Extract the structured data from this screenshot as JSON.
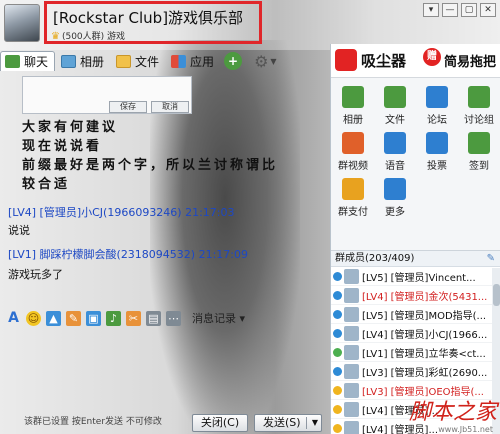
{
  "header": {
    "title": "[Rockstar Club]游戏俱乐部",
    "subtitle": "(500人群) 游戏",
    "win_buttons": [
      "▾",
      "—",
      "▢",
      "✕"
    ]
  },
  "tabs": [
    {
      "label": "聊天",
      "icon": "chat-bubble-icon"
    },
    {
      "label": "相册",
      "icon": "photo-album-icon"
    },
    {
      "label": "文件",
      "icon": "folder-icon"
    },
    {
      "label": "应用",
      "icon": "app-grid-icon"
    }
  ],
  "popup": {
    "save_label": "保存",
    "cancel_label": "取消"
  },
  "notice": {
    "lines": [
      "大家有何建议",
      "现在说说看",
      "前缀最好是两个字，所以兰讨称谓比",
      "较合适"
    ]
  },
  "messages": [
    {
      "header": "[LV4] [管理员]小CJ(1966093246) 21:17:03",
      "body": "说说"
    },
    {
      "header": "[LV1] 脚踩柠檬脚会酸(2318094532) 21:17:09",
      "body": "游戏玩多了"
    }
  ],
  "toolbar": {
    "history_label": "消息记录"
  },
  "input": {
    "hint": "该群已设置 按Enter发送 不可修改"
  },
  "buttons": {
    "close_label": "关闭(C)",
    "send_label": "发送(S)"
  },
  "right_panel": {
    "ad": {
      "text1": "吸尘器",
      "badge": "赠",
      "text2": "简易拖把"
    },
    "apps": [
      {
        "label": "相册",
        "icon": "album-icon",
        "color": "#4c9a3f"
      },
      {
        "label": "文件",
        "icon": "file-icon",
        "color": "#4c9a3f"
      },
      {
        "label": "论坛",
        "icon": "forum-icon",
        "color": "#2e7fd0"
      },
      {
        "label": "讨论组",
        "icon": "discussion-icon",
        "color": "#4c9a3f"
      },
      {
        "label": "群视频",
        "icon": "video-icon",
        "color": "#e0602a"
      },
      {
        "label": "语音",
        "icon": "voice-icon",
        "color": "#2e7fd0"
      },
      {
        "label": "投票",
        "icon": "vote-icon",
        "color": "#2e7fd0"
      },
      {
        "label": "签到",
        "icon": "checkin-icon",
        "color": "#4c9a3f"
      },
      {
        "label": "群支付",
        "icon": "pay-icon",
        "color": "#e8a21f"
      },
      {
        "label": "更多",
        "icon": "more-icon",
        "color": "#2e7fd0"
      }
    ],
    "members_header": "群成员(203/409)",
    "members": [
      {
        "label": "[LV5] [管理员]Vincent...",
        "badge": "o",
        "red": false
      },
      {
        "label": "[LV4] [管理员]金次(5431...",
        "badge": "o",
        "red": true
      },
      {
        "label": "[LV5] [管理员]MOD指导(...",
        "badge": "o",
        "red": false
      },
      {
        "label": "[LV4] [管理员]小CJ(1966...",
        "badge": "o",
        "red": false
      },
      {
        "label": "[LV1] [管理员]立华奏<ct...",
        "badge": "g",
        "red": false
      },
      {
        "label": "[LV3] [管理员]彩虹(2690...",
        "badge": "o",
        "red": false
      },
      {
        "label": "[LV3] [管理员]OEO指导(...",
        "badge": "s",
        "red": true
      },
      {
        "label": "[LV4] [管理员]...",
        "badge": "s",
        "red": false
      },
      {
        "label": "[LV4] [管理员]...",
        "badge": "s",
        "red": false
      }
    ],
    "watermark": "脚本之家",
    "watermark_url": "www.Jb51.net"
  }
}
